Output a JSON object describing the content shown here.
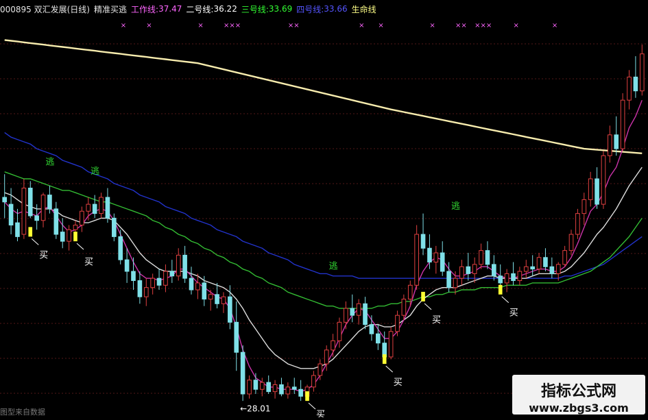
{
  "header": {
    "code": "000895 双汇发展(日线)",
    "indicator": "精准买逃",
    "work": {
      "label": "工作线:",
      "value": "37.47",
      "color": "#ff66ff"
    },
    "line2": {
      "label": "二号线:",
      "value": "36.22",
      "color": "#ffffff"
    },
    "line3": {
      "label": "三号线:",
      "value": "33.69",
      "color": "#33ff33"
    },
    "line4": {
      "label": "四号线:",
      "value": "33.66",
      "color": "#5555ff"
    },
    "life": {
      "label": "生命线",
      "color": "#ffff88"
    }
  },
  "watermark": {
    "line1": "指标公式网",
    "line2": "www.zbgs3.com"
  },
  "footer": {
    "text": "图型来自数据"
  },
  "chart_data": {
    "type": "candlestick",
    "title": "000895 双汇发展(日线)",
    "ylim": [
      27.5,
      44.5
    ],
    "low_annotation": "28.01",
    "candles": [
      [
        36.8,
        37.8,
        35.9,
        36.6
      ],
      [
        36.5,
        37.2,
        35.2,
        35.6
      ],
      [
        35.7,
        36.3,
        34.9,
        35.1
      ],
      [
        35.2,
        37.6,
        35.0,
        37.2
      ],
      [
        37.2,
        37.5,
        35.9,
        36.0
      ],
      [
        36.0,
        36.5,
        35.4,
        35.8
      ],
      [
        35.8,
        37.0,
        35.5,
        36.9
      ],
      [
        36.9,
        37.3,
        36.1,
        36.3
      ],
      [
        36.3,
        36.6,
        35.0,
        35.2
      ],
      [
        35.3,
        35.9,
        34.6,
        34.9
      ],
      [
        34.9,
        35.6,
        34.5,
        35.4
      ],
      [
        35.4,
        35.8,
        35.1,
        35.6
      ],
      [
        35.6,
        36.4,
        35.3,
        36.2
      ],
      [
        36.2,
        36.8,
        35.8,
        36.5
      ],
      [
        36.5,
        36.9,
        35.9,
        36.1
      ],
      [
        36.1,
        37.0,
        35.9,
        36.8
      ],
      [
        36.8,
        37.2,
        35.7,
        35.9
      ],
      [
        35.9,
        36.1,
        34.9,
        35.1
      ],
      [
        35.1,
        35.4,
        33.9,
        34.1
      ],
      [
        34.1,
        34.6,
        33.1,
        33.6
      ],
      [
        33.6,
        34.2,
        32.8,
        33.2
      ],
      [
        33.2,
        33.6,
        32.2,
        32.5
      ],
      [
        32.5,
        33.3,
        32.1,
        32.9
      ],
      [
        32.9,
        33.5,
        32.6,
        33.3
      ],
      [
        33.3,
        33.7,
        32.8,
        33.0
      ],
      [
        33.0,
        33.9,
        32.7,
        33.6
      ],
      [
        33.6,
        34.1,
        33.1,
        33.4
      ],
      [
        33.4,
        34.6,
        33.2,
        34.3
      ],
      [
        34.3,
        34.7,
        33.1,
        33.3
      ],
      [
        33.3,
        33.8,
        32.6,
        32.8
      ],
      [
        32.8,
        33.5,
        32.4,
        33.1
      ],
      [
        33.1,
        33.4,
        32.1,
        32.4
      ],
      [
        32.4,
        32.8,
        31.9,
        32.6
      ],
      [
        32.6,
        33.1,
        32.0,
        32.2
      ],
      [
        32.2,
        32.7,
        31.8,
        32.5
      ],
      [
        32.5,
        33.0,
        31.1,
        31.4
      ],
      [
        31.4,
        32.3,
        29.3,
        30.1
      ],
      [
        30.1,
        30.4,
        28.0,
        28.3
      ],
      [
        28.3,
        29.1,
        28.1,
        28.9
      ],
      [
        28.9,
        29.2,
        28.3,
        28.5
      ],
      [
        28.5,
        29.0,
        28.2,
        28.8
      ],
      [
        28.8,
        29.1,
        28.3,
        28.4
      ],
      [
        28.4,
        28.9,
        28.1,
        28.7
      ],
      [
        28.7,
        29.0,
        28.2,
        28.3
      ],
      [
        28.3,
        28.8,
        28.1,
        28.6
      ],
      [
        28.6,
        29.0,
        28.3,
        28.5
      ],
      [
        28.5,
        28.9,
        28.0,
        28.2
      ],
      [
        28.2,
        28.7,
        28.0,
        28.6
      ],
      [
        28.6,
        29.3,
        28.4,
        29.1
      ],
      [
        29.1,
        29.8,
        28.9,
        29.6
      ],
      [
        29.6,
        30.4,
        29.3,
        30.2
      ],
      [
        30.2,
        30.9,
        29.9,
        30.6
      ],
      [
        30.6,
        31.6,
        30.3,
        31.4
      ],
      [
        31.4,
        32.3,
        31.1,
        32.0
      ],
      [
        32.0,
        32.6,
        31.4,
        31.7
      ],
      [
        31.7,
        32.4,
        31.3,
        32.2
      ],
      [
        32.2,
        32.5,
        31.1,
        31.3
      ],
      [
        31.3,
        31.7,
        30.6,
        30.9
      ],
      [
        30.9,
        31.3,
        30.2,
        30.5
      ],
      [
        30.5,
        31.0,
        29.6,
        29.9
      ],
      [
        29.9,
        31.2,
        29.8,
        31.0
      ],
      [
        31.0,
        31.9,
        30.8,
        31.7
      ],
      [
        31.7,
        32.6,
        31.5,
        32.4
      ],
      [
        32.4,
        33.2,
        32.1,
        33.0
      ],
      [
        33.0,
        35.6,
        32.8,
        35.2
      ],
      [
        35.2,
        36.1,
        34.3,
        34.6
      ],
      [
        34.6,
        35.2,
        33.7,
        34.0
      ],
      [
        34.0,
        34.7,
        33.5,
        34.4
      ],
      [
        34.4,
        34.9,
        33.4,
        33.6
      ],
      [
        33.6,
        34.0,
        32.7,
        32.9
      ],
      [
        32.9,
        33.6,
        32.6,
        33.3
      ],
      [
        33.3,
        34.1,
        33.0,
        33.8
      ],
      [
        33.8,
        34.4,
        33.2,
        33.5
      ],
      [
        33.5,
        34.2,
        33.1,
        33.9
      ],
      [
        33.9,
        34.8,
        33.7,
        34.5
      ],
      [
        34.5,
        34.9,
        33.7,
        33.9
      ],
      [
        33.9,
        34.3,
        33.2,
        33.4
      ],
      [
        33.4,
        33.9,
        32.8,
        33.1
      ],
      [
        33.1,
        33.7,
        32.7,
        33.5
      ],
      [
        33.5,
        34.0,
        33.0,
        33.2
      ],
      [
        33.2,
        33.8,
        33.0,
        33.6
      ],
      [
        33.6,
        34.1,
        33.3,
        33.8
      ],
      [
        33.8,
        34.3,
        33.4,
        33.7
      ],
      [
        33.7,
        34.4,
        33.5,
        34.2
      ],
      [
        34.2,
        34.6,
        33.6,
        33.8
      ],
      [
        33.8,
        34.2,
        33.3,
        33.5
      ],
      [
        33.5,
        34.0,
        33.2,
        33.9
      ],
      [
        33.9,
        34.7,
        33.8,
        34.5
      ],
      [
        34.5,
        35.4,
        34.3,
        35.2
      ],
      [
        35.2,
        36.3,
        35.0,
        36.1
      ],
      [
        36.1,
        37.0,
        35.6,
        36.7
      ],
      [
        36.7,
        37.9,
        36.4,
        37.6
      ],
      [
        37.6,
        38.1,
        36.3,
        36.5
      ],
      [
        36.5,
        38.8,
        36.3,
        38.6
      ],
      [
        38.6,
        39.9,
        38.3,
        39.5
      ],
      [
        39.5,
        40.3,
        38.6,
        38.9
      ],
      [
        38.9,
        41.3,
        38.8,
        41.0
      ],
      [
        41.0,
        42.3,
        40.6,
        42.0
      ],
      [
        42.0,
        42.9,
        41.1,
        41.4
      ],
      [
        41.4,
        43.4,
        41.2,
        43.0
      ]
    ],
    "series": [
      {
        "name": "生命线",
        "color": "#f7ecae",
        "x": [
          0,
          30,
          60,
          90,
          99
        ],
        "values": [
          43.6,
          42.6,
          40.6,
          38.9,
          38.7
        ]
      },
      {
        "name": "四号线",
        "color": "#2233cc",
        "values": [
          39.6,
          39.4,
          39.3,
          39.2,
          39.1,
          38.9,
          38.8,
          38.7,
          38.6,
          38.4,
          38.3,
          38.2,
          38.1,
          37.9,
          37.8,
          37.7,
          37.6,
          37.4,
          37.3,
          37.2,
          37.1,
          36.9,
          36.8,
          36.7,
          36.6,
          36.4,
          36.3,
          36.2,
          36.1,
          35.9,
          35.8,
          35.7,
          35.6,
          35.4,
          35.3,
          35.2,
          35.1,
          34.9,
          34.8,
          34.7,
          34.6,
          34.4,
          34.3,
          34.2,
          34.1,
          33.9,
          33.8,
          33.7,
          33.6,
          33.5,
          33.5,
          33.4,
          33.4,
          33.4,
          33.4,
          33.3,
          33.3,
          33.3,
          33.3,
          33.3,
          33.3,
          33.3,
          33.3,
          33.3,
          33.3,
          33.3,
          33.3,
          33.3,
          33.3,
          33.3,
          33.3,
          33.3,
          33.3,
          33.3,
          33.3,
          33.3,
          33.3,
          33.3,
          33.3,
          33.3,
          33.3,
          33.3,
          33.3,
          33.3,
          33.3,
          33.3,
          33.3,
          33.4,
          33.4,
          33.5,
          33.6,
          33.7,
          33.8,
          33.9,
          34.1,
          34.3,
          34.5,
          34.7,
          34.9,
          35.1
        ]
      },
      {
        "name": "三号线",
        "color": "#33bb33",
        "values": [
          37.9,
          37.8,
          37.7,
          37.6,
          37.6,
          37.5,
          37.4,
          37.3,
          37.2,
          37.1,
          37.1,
          37.0,
          36.9,
          36.8,
          36.7,
          36.6,
          36.6,
          36.5,
          36.4,
          36.3,
          36.2,
          36.1,
          36.0,
          35.8,
          35.7,
          35.5,
          35.4,
          35.2,
          35.1,
          34.9,
          34.8,
          34.6,
          34.5,
          34.3,
          34.2,
          34.0,
          33.9,
          33.7,
          33.6,
          33.4,
          33.3,
          33.1,
          33.0,
          32.9,
          32.7,
          32.6,
          32.5,
          32.4,
          32.3,
          32.2,
          32.1,
          32.1,
          32.0,
          32.0,
          32.0,
          32.0,
          32.0,
          32.0,
          32.1,
          32.1,
          32.2,
          32.2,
          32.3,
          32.3,
          32.4,
          32.5,
          32.5,
          32.6,
          32.6,
          32.7,
          32.7,
          32.8,
          32.8,
          32.8,
          32.9,
          32.9,
          32.9,
          32.9,
          33.0,
          33.0,
          33.0,
          33.0,
          33.1,
          33.1,
          33.1,
          33.1,
          33.1,
          33.2,
          33.3,
          33.4,
          33.5,
          33.6,
          33.8,
          34.0,
          34.2,
          34.5,
          34.8,
          35.1,
          35.5,
          35.9
        ]
      },
      {
        "name": "二号线",
        "color": "#dddddd",
        "values": [
          37.0,
          36.9,
          36.7,
          36.5,
          36.4,
          36.3,
          36.3,
          36.3,
          36.2,
          36.0,
          35.9,
          35.8,
          35.7,
          35.7,
          35.8,
          35.9,
          35.9,
          35.8,
          35.5,
          35.2,
          34.8,
          34.4,
          34.1,
          33.9,
          33.7,
          33.6,
          33.6,
          33.6,
          33.6,
          33.5,
          33.4,
          33.2,
          33.1,
          33.0,
          32.9,
          32.7,
          32.4,
          32.0,
          31.5,
          31.1,
          30.7,
          30.3,
          30.0,
          29.8,
          29.6,
          29.5,
          29.4,
          29.4,
          29.4,
          29.5,
          29.6,
          29.8,
          30.1,
          30.4,
          30.7,
          31.0,
          31.2,
          31.3,
          31.3,
          31.2,
          31.2,
          31.3,
          31.5,
          31.7,
          32.1,
          32.4,
          32.6,
          32.8,
          32.9,
          32.9,
          32.9,
          33.0,
          33.1,
          33.2,
          33.3,
          33.4,
          33.4,
          33.3,
          33.3,
          33.3,
          33.3,
          33.3,
          33.4,
          33.5,
          33.5,
          33.5,
          33.5,
          33.6,
          33.8,
          34.1,
          34.4,
          34.8,
          35.2,
          35.5,
          35.9,
          36.3,
          36.8,
          37.3,
          37.7,
          38.1
        ]
      },
      {
        "name": "工作线",
        "color": "#cc33aa",
        "values": [
          36.6,
          36.3,
          36.1,
          36.2,
          36.1,
          36.0,
          36.3,
          36.4,
          36.0,
          35.6,
          35.3,
          35.4,
          35.6,
          36.0,
          36.2,
          36.3,
          36.2,
          35.8,
          35.2,
          34.6,
          34.0,
          33.5,
          33.3,
          33.3,
          33.2,
          33.3,
          33.4,
          33.7,
          33.7,
          33.4,
          33.1,
          32.9,
          32.7,
          32.5,
          32.4,
          32.0,
          31.2,
          30.2,
          29.5,
          29.0,
          28.8,
          28.6,
          28.6,
          28.5,
          28.5,
          28.5,
          28.4,
          28.5,
          28.7,
          29.1,
          29.6,
          30.1,
          30.7,
          31.3,
          31.7,
          32.0,
          31.9,
          31.5,
          31.1,
          30.7,
          30.7,
          31.0,
          31.5,
          32.1,
          33.0,
          33.6,
          34.0,
          34.2,
          34.1,
          33.7,
          33.4,
          33.4,
          33.5,
          33.6,
          33.8,
          33.8,
          33.6,
          33.4,
          33.3,
          33.3,
          33.4,
          33.5,
          33.6,
          33.7,
          33.7,
          33.6,
          33.6,
          33.8,
          34.2,
          34.8,
          35.5,
          36.2,
          36.5,
          37.0,
          37.7,
          38.1,
          38.9,
          39.8,
          40.3,
          41.0
        ]
      }
    ],
    "annotations": [
      {
        "type": "buy",
        "text": "买",
        "x": 4,
        "y": 35.1,
        "yText": 34.6
      },
      {
        "type": "buy",
        "text": "买",
        "x": 11,
        "y": 34.9,
        "yText": 34.3
      },
      {
        "type": "escape",
        "text": "逃",
        "x": 7,
        "y": 38.2
      },
      {
        "type": "escape",
        "text": "逃",
        "x": 14,
        "y": 37.8
      },
      {
        "type": "buy",
        "text": "买",
        "x": 47,
        "y": 28.0,
        "yText": 27.7
      },
      {
        "type": "escape",
        "text": "逃",
        "x": 51,
        "y": 33.7
      },
      {
        "type": "buy",
        "text": "买",
        "x": 59,
        "y": 29.6,
        "yText": 29.1
      },
      {
        "type": "escape",
        "text": "逃",
        "x": 70,
        "y": 36.3
      },
      {
        "type": "buy",
        "text": "买",
        "x": 65,
        "y": 32.3,
        "yText": 31.8
      },
      {
        "type": "buy",
        "text": "买",
        "x": 77,
        "y": 32.6,
        "yText": 32.1
      }
    ],
    "top_markers": [
      {
        "x": 18,
        "text": "×"
      },
      {
        "x": 22,
        "text": "×"
      },
      {
        "x": 30,
        "text": "×"
      },
      {
        "x": 34,
        "text": "×××"
      },
      {
        "x": 44,
        "text": "××"
      },
      {
        "x": 55,
        "text": "×"
      },
      {
        "x": 58,
        "text": "×"
      },
      {
        "x": 66,
        "text": "×"
      },
      {
        "x": 70,
        "text": "××"
      },
      {
        "x": 73,
        "text": "×××"
      },
      {
        "x": 79,
        "text": "×"
      },
      {
        "x": 85,
        "text": "×"
      }
    ],
    "grid": true,
    "legend": "top-left"
  }
}
